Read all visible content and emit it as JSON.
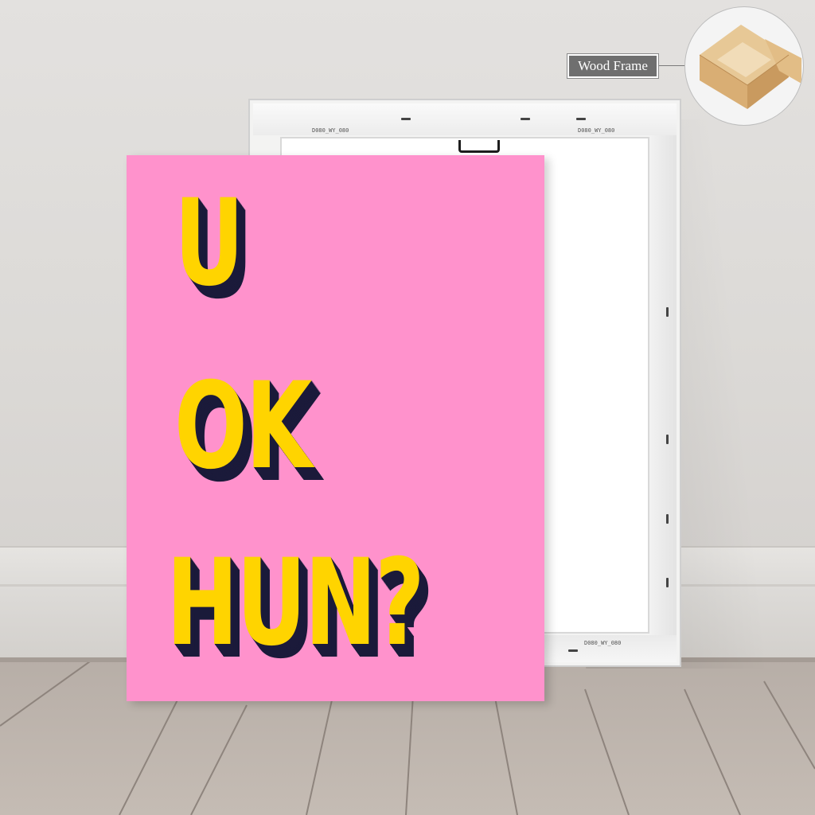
{
  "poster": {
    "line1": "U",
    "line2": "OK",
    "line3": "HUN?"
  },
  "callout": {
    "label": "Wood Frame"
  },
  "frame_print": {
    "top_left": "D080_WY_080",
    "top_right": "D080_WY_080",
    "bottom": "D080_WY_080"
  },
  "colors": {
    "canvas": "#ff92cc",
    "text": "#ffd400",
    "text_shadow": "#1b1a3a",
    "wall": "#e0dedb",
    "floor": "#c2b9b1"
  },
  "icons": {
    "callout_image": "wood-frame-corner-icon"
  }
}
